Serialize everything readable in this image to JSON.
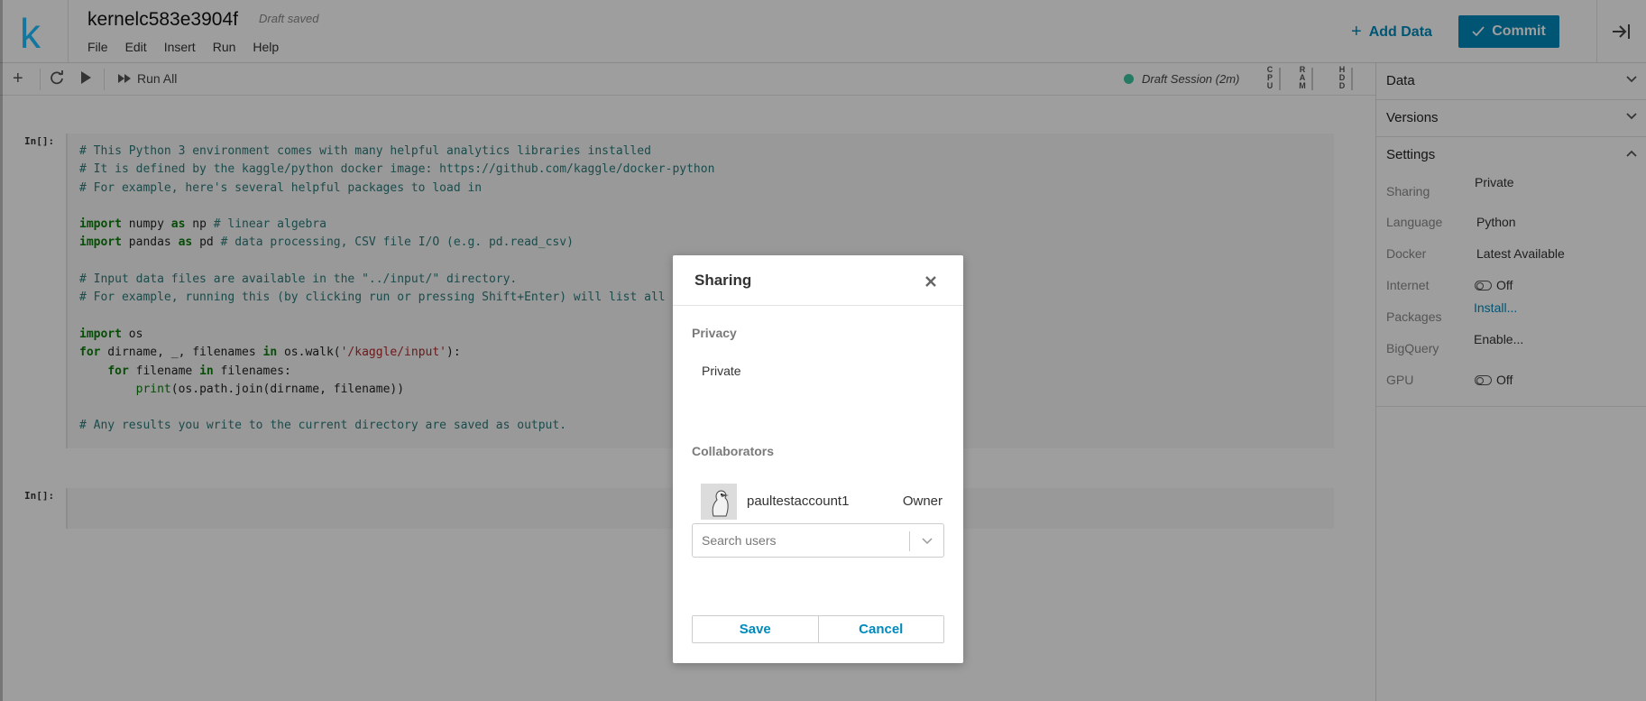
{
  "header": {
    "logo": "k",
    "title": "kernelc583e3904f",
    "status": "Draft saved",
    "menu": [
      "File",
      "Edit",
      "Insert",
      "Run",
      "Help"
    ],
    "add_data_label": "Add Data",
    "commit_label": "Commit"
  },
  "toolbar": {
    "run_all_label": "Run All",
    "session_label": "Draft Session (2m)",
    "meters": [
      {
        "label": "CPU",
        "lines": [
          "C",
          "P",
          "U"
        ]
      },
      {
        "label": "RAM",
        "lines": [
          "R",
          "A",
          "M"
        ]
      },
      {
        "label": "HDD",
        "lines": [
          "H",
          "D",
          "D"
        ]
      }
    ]
  },
  "cells": [
    {
      "prompt": "In[]:"
    },
    {
      "prompt": "In[]:"
    }
  ],
  "panel": {
    "sections": {
      "data": "Data",
      "versions": "Versions",
      "settings": "Settings"
    },
    "settings": {
      "sharing_label": "Sharing",
      "sharing_value": "Private",
      "language_label": "Language",
      "language_value": "Python",
      "docker_label": "Docker",
      "docker_value": "Latest Available",
      "internet_label": "Internet",
      "internet_value": "Off",
      "packages_label": "Packages",
      "packages_value": "Install...",
      "bigquery_label": "BigQuery",
      "bigquery_value": "Enable...",
      "gpu_label": "GPU",
      "gpu_value": "Off"
    }
  },
  "modal": {
    "title": "Sharing",
    "privacy_label": "Privacy",
    "privacy_value": "Private",
    "collaborators_label": "Collaborators",
    "collaborator_name": "paultestaccount1",
    "collaborator_role": "Owner",
    "search_placeholder": "Search users",
    "save_label": "Save",
    "cancel_label": "Cancel"
  },
  "colors": {
    "accent": "#008abc",
    "logo": "#20beff",
    "session_dot": "#3cc5a0"
  }
}
